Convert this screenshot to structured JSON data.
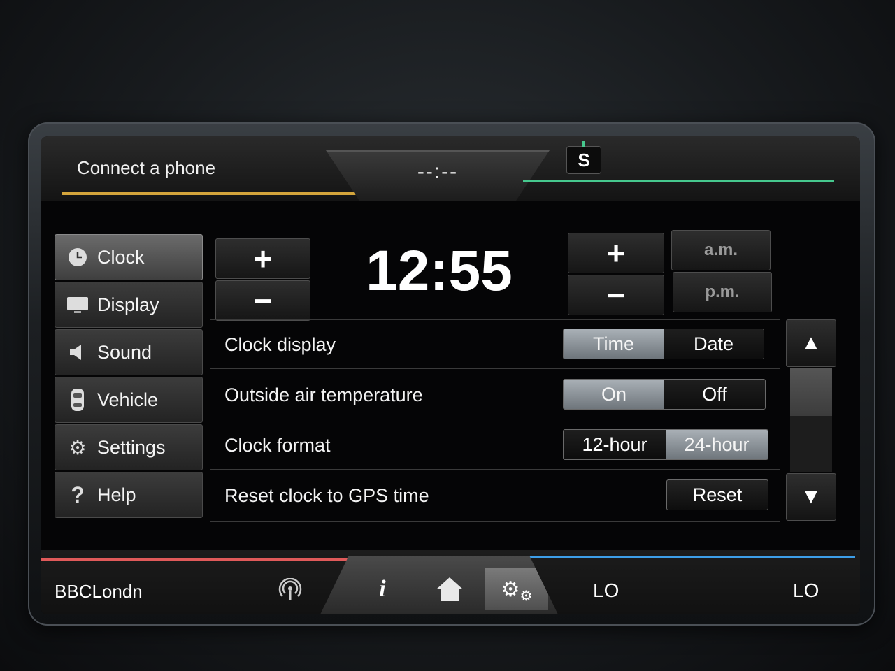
{
  "topbar": {
    "phone_label": "Connect a phone",
    "clock_placeholder": "--:--",
    "gps_indicator": "S"
  },
  "nav": {
    "items": [
      {
        "label": "Clock",
        "icon": "clock-icon",
        "active": true
      },
      {
        "label": "Display",
        "icon": "display-icon"
      },
      {
        "label": "Sound",
        "icon": "speaker-icon"
      },
      {
        "label": "Vehicle",
        "icon": "car-icon"
      },
      {
        "label": "Settings",
        "icon": "gear-icon"
      },
      {
        "label": "Help",
        "icon": "help-icon"
      }
    ]
  },
  "time": {
    "value": "12:55",
    "plus": "+",
    "minus": "−",
    "am": "a.m.",
    "pm": "p.m."
  },
  "settings": {
    "clock_display": {
      "label": "Clock display",
      "options": [
        "Time",
        "Date"
      ],
      "selected": "Time"
    },
    "outside_temp": {
      "label": "Outside air temperature",
      "options": [
        "On",
        "Off"
      ],
      "selected": "On"
    },
    "clock_format": {
      "label": "Clock format",
      "options": [
        "12-hour",
        "24-hour"
      ],
      "selected": "24-hour"
    },
    "reset_gps": {
      "label": "Reset clock to GPS time",
      "button": "Reset"
    }
  },
  "scroll": {
    "up": "▲",
    "down": "▼"
  },
  "bottombar": {
    "station": "BBCLondn",
    "info_label": "i",
    "climate_left": "LO",
    "climate_right": "LO"
  },
  "colors": {
    "accent_top_left": "#d4a53c",
    "accent_top_right": "#46c88e",
    "accent_bottom_left": "#e05a5a",
    "accent_bottom_right": "#3d9ee8",
    "selected_segment": "#a9b0b6"
  }
}
